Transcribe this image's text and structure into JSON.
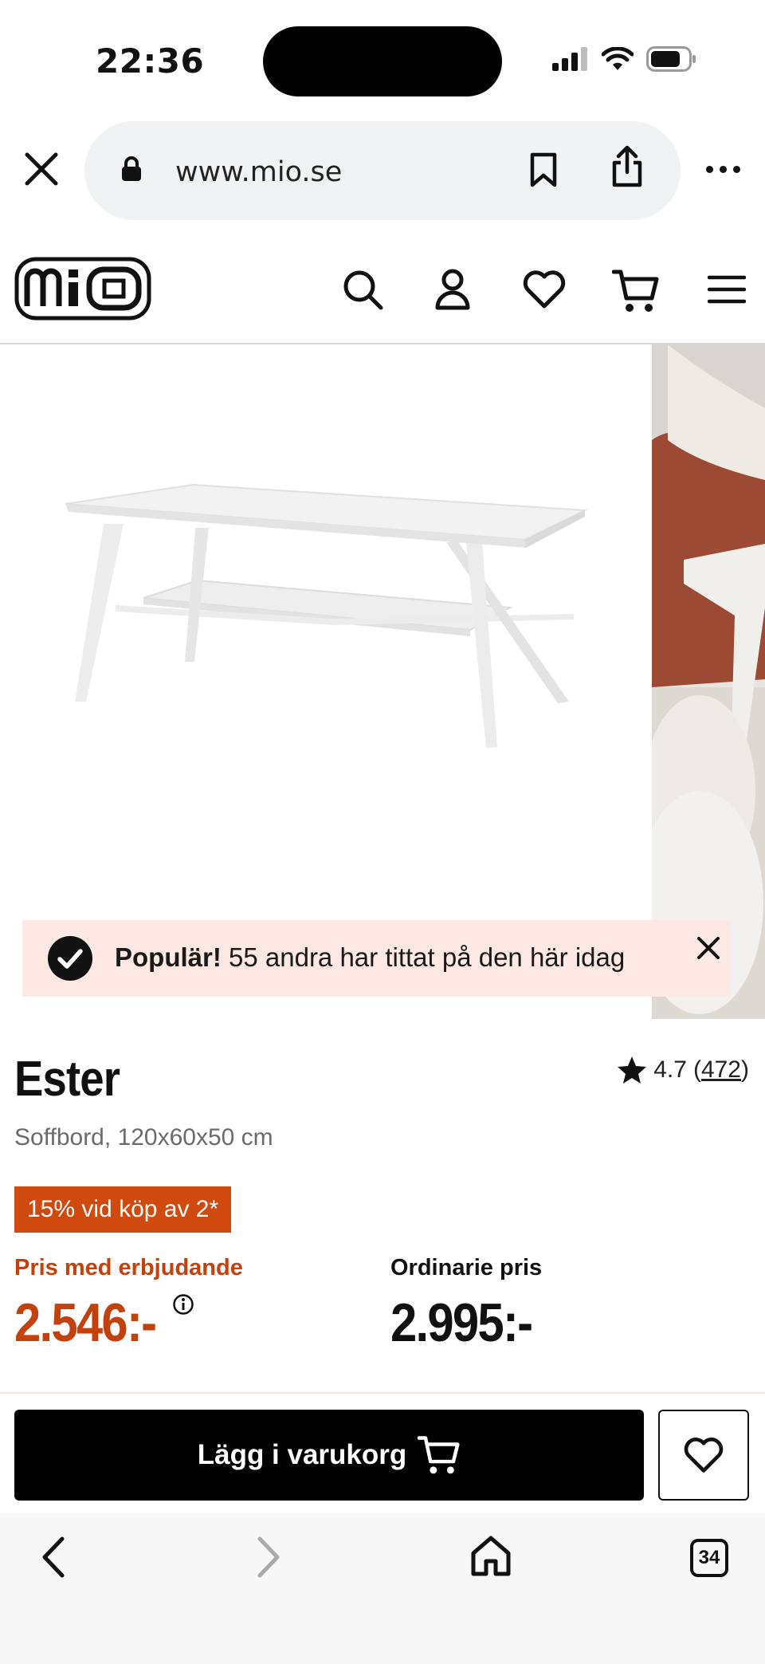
{
  "status_bar": {
    "time": "22:36"
  },
  "browser": {
    "url": "www.mio.se",
    "icons": [
      "close-icon",
      "lock-icon",
      "bookmark-icon",
      "share-icon",
      "more-icon"
    ]
  },
  "header": {
    "logo_text": "mio",
    "icons": [
      "search-icon",
      "account-icon",
      "heart-icon",
      "cart-icon",
      "menu-icon"
    ]
  },
  "popular_banner": {
    "bold": "Populär!",
    "text": " 55 andra har tittat på den här idag"
  },
  "product": {
    "name": "Ester",
    "subtitle": "Soffbord, 120x60x50 cm",
    "rating": "4.7",
    "rating_count_open": "(",
    "rating_count": "472",
    "rating_count_close": ")"
  },
  "promo": {
    "badge": "15% vid köp av 2*"
  },
  "pricing": {
    "offer_label": "Pris med erbjudande",
    "offer_price": "2.546:-",
    "regular_label": "Ordinarie pris",
    "regular_price": "2.995:-"
  },
  "actions": {
    "add_to_cart": "Lägg i varukorg"
  },
  "toolbar": {
    "tab_count": "34"
  },
  "colors": {
    "accent": "#c2410c",
    "promo_badge": "#d04a0f",
    "banner_bg": "#fde8e3",
    "button_bg": "#000000"
  }
}
